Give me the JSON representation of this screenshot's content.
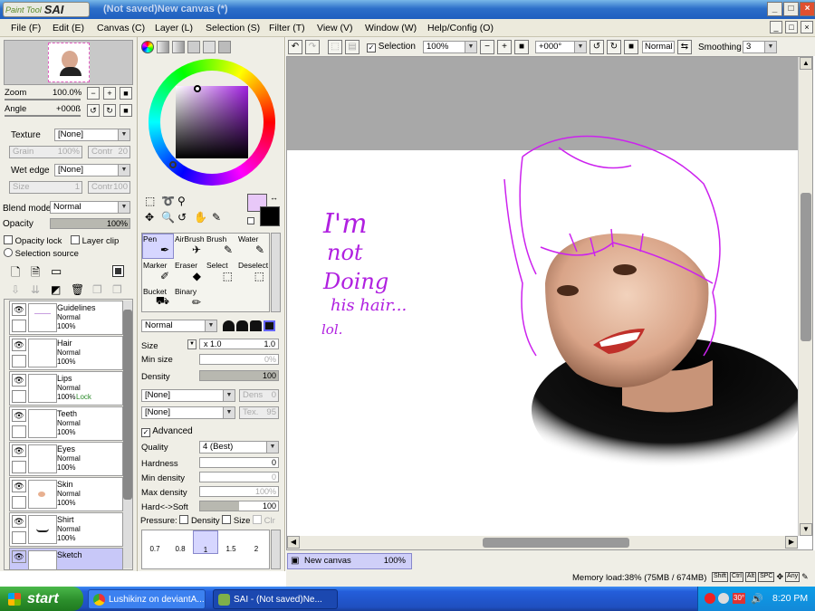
{
  "app": {
    "logo_small": "Paint Tool",
    "logo_big": "SAI",
    "title": "(Not saved)New canvas (*)"
  },
  "menu": [
    "File (F)",
    "Edit (E)",
    "Canvas (C)",
    "Layer (L)",
    "Selection (S)",
    "Filter (T)",
    "View (V)",
    "Window (W)",
    "Help/Config (O)"
  ],
  "nav": {
    "zoom_label": "Zoom",
    "zoom_value": "100.0%",
    "angle_label": "Angle",
    "angle_value": "+000ß"
  },
  "texture": {
    "label": "Texture",
    "value": "[None]",
    "grain_label": "Grain",
    "grain_value": "100%",
    "contr_label": "Contr",
    "contr_value": "20"
  },
  "wet_edge": {
    "label": "Wet edge",
    "value": "[None]",
    "size_label": "Size",
    "size_value": "1",
    "contr_label": "Contr",
    "contr_value": "100"
  },
  "blend": {
    "label": "Blend mode",
    "value": "Normal",
    "opacity_label": "Opacity",
    "opacity_value": "100%",
    "opacity_fraction": 1.0,
    "opacity_lock": "Opacity lock",
    "layer_clip": "Layer clip",
    "selection_source": "Selection source"
  },
  "layers": [
    {
      "name": "Guidelines",
      "mode": "Normal",
      "opacity": "100%",
      "lock": ""
    },
    {
      "name": "Hair",
      "mode": "Normal",
      "opacity": "100%",
      "lock": ""
    },
    {
      "name": "Lips",
      "mode": "Normal",
      "opacity": "100%",
      "lock": "Lock"
    },
    {
      "name": "Teeth",
      "mode": "Normal",
      "opacity": "100%",
      "lock": ""
    },
    {
      "name": "Eyes",
      "mode": "Normal",
      "opacity": "100%",
      "lock": ""
    },
    {
      "name": "Skin",
      "mode": "Normal",
      "opacity": "100%",
      "lock": ""
    },
    {
      "name": "Shirt",
      "mode": "Normal",
      "opacity": "100%",
      "lock": ""
    },
    {
      "name": "Sketch",
      "mode": "",
      "opacity": "",
      "lock": ""
    }
  ],
  "colors": {
    "main": "#e8c8f8",
    "sub": "#000000",
    "accent": "#cc22ee"
  },
  "tools": [
    {
      "label": "Pen",
      "icon": "pen-icon",
      "glyph": "✒"
    },
    {
      "label": "AirBrush",
      "icon": "airbrush-icon",
      "glyph": "✈"
    },
    {
      "label": "Brush",
      "icon": "brush-icon",
      "glyph": "🖌"
    },
    {
      "label": "Water",
      "icon": "water-icon",
      "glyph": "✎"
    },
    {
      "label": "Marker",
      "icon": "marker-icon",
      "glyph": "✐"
    },
    {
      "label": "Eraser",
      "icon": "eraser-icon",
      "glyph": "◆"
    },
    {
      "label": "Select",
      "icon": "select-icon",
      "glyph": "⬚"
    },
    {
      "label": "Deselect",
      "icon": "deselect-icon",
      "glyph": "⬚"
    },
    {
      "label": "Bucket",
      "icon": "bucket-icon",
      "glyph": "⛟"
    },
    {
      "label": "Binary",
      "icon": "binary-icon",
      "glyph": "✏"
    }
  ],
  "brush": {
    "mode": "Normal",
    "size_label": "Size",
    "size_mult": "x 1.0",
    "size_value": "1.0",
    "min_size_label": "Min size",
    "min_size_value": "0%",
    "density_label": "Density",
    "density_value": "100",
    "tex1": "[None]",
    "dens_label": "Dens",
    "dens_value": "0",
    "tex2": "[None]",
    "tex_label": "Tex.",
    "tex_value": "95",
    "advanced_label": "Advanced",
    "quality_label": "Quality",
    "quality_value": "4 (Best)",
    "hardness_label": "Hardness",
    "hardness_value": "0",
    "min_density_label": "Min density",
    "min_density_value": "0",
    "max_density_label": "Max density",
    "max_density_value": "100%",
    "hardsoft_label": "Hard<->Soft",
    "hardsoft_value": "100",
    "pressure_label": "Pressure:",
    "pressure_density": "Density",
    "pressure_size": "Size",
    "pressure_clr": "Clr",
    "sizes": [
      "0.7",
      "0.8",
      "1",
      "1.5",
      "2"
    ]
  },
  "canvas_toolbar": {
    "selection_label": "Selection",
    "zoom": "100%",
    "angle": "+000°",
    "blend": "Normal",
    "smoothing_label": "Smoothing",
    "smoothing_value": "3"
  },
  "canvas_text": [
    "I'm",
    "not",
    "Doing",
    "his hair...",
    "lol."
  ],
  "tab": {
    "name": "New canvas",
    "zoom": "100%"
  },
  "status": {
    "memory": "Memory load:38% (75MB / 674MB)",
    "keys": [
      "Shift",
      "Ctrl",
      "Alt",
      "SPC",
      "Any"
    ]
  },
  "taskbar": {
    "start": "start",
    "tasks": [
      "Lushikinz on deviantA...",
      "SAI - (Not saved)Ne..."
    ],
    "tray_badge": "30°",
    "clock": "8:20 PM"
  }
}
